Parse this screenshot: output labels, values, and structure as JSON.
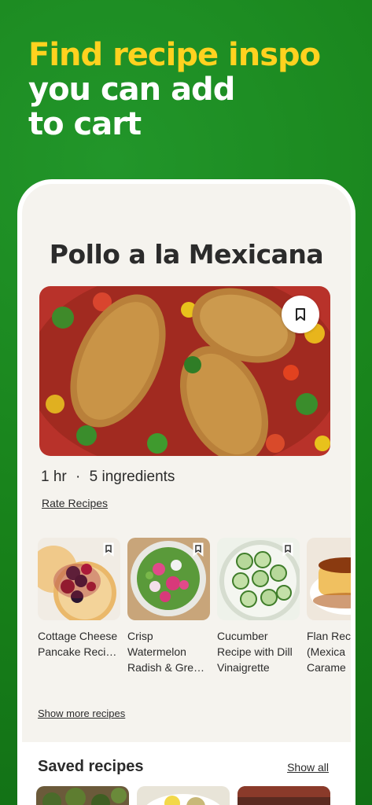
{
  "headline": {
    "line1": "Find recipe inspo",
    "line2": "you can add",
    "line3": "to cart"
  },
  "recipe": {
    "title": "Pollo a la Mexicana",
    "time": "1 hr",
    "separator": "·",
    "ingredients": "5 ingredients",
    "rate_link": "Rate Recipes",
    "bookmark_icon": "bookmark-icon"
  },
  "related": {
    "items": [
      {
        "name": "Cottage Cheese Pancake Reci…"
      },
      {
        "name": "Crisp Watermelon Radish & Gre…"
      },
      {
        "name": "Cucumber Recipe with Dill Vinaigrette"
      },
      {
        "name": "Flan Rec (Mexica Carame"
      }
    ],
    "show_more": "Show more recipes"
  },
  "saved": {
    "title": "Saved recipes",
    "show_all": "Show all"
  },
  "colors": {
    "background": "#1a8a1f",
    "accent_yellow": "#ffd21f",
    "card_bg": "#f5f3ee"
  }
}
